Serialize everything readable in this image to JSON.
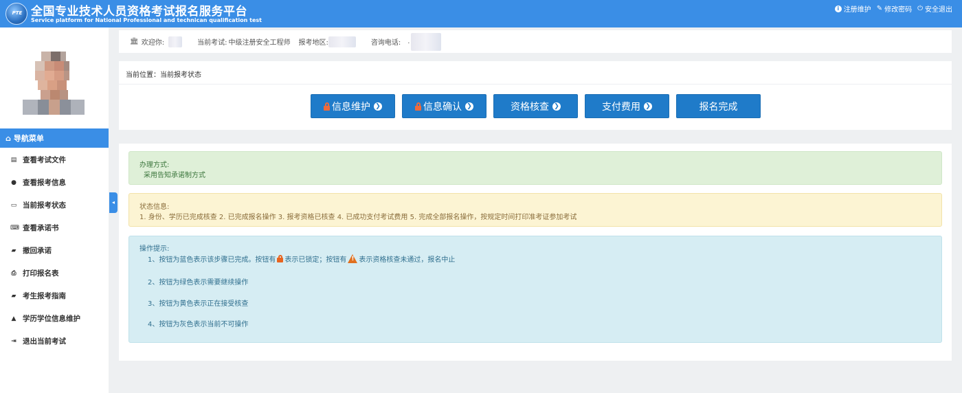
{
  "header": {
    "logo_text": "PTE",
    "title_cn": "全国专业技术人员资格考试报名服务平台",
    "title_en": "Service platform for National Professional and technican qualification test",
    "links": [
      {
        "label": "注册维护",
        "icon": "info-icon"
      },
      {
        "label": "修改密码",
        "icon": "edit-icon"
      },
      {
        "label": "安全退出",
        "icon": "power-icon"
      }
    ]
  },
  "infobar": {
    "welcome_label": "欢迎你:",
    "exam_label": "当前考试:",
    "exam_value": "中级注册安全工程师",
    "region_label": "报考地区:",
    "phone_label": "咨询电话:",
    "phone_prefix": "."
  },
  "sidebar": {
    "nav_header": "导航菜单",
    "items": [
      {
        "label": "查看考试文件",
        "icon": "file-icon"
      },
      {
        "label": "查看报考信息",
        "icon": "info-circle-icon"
      },
      {
        "label": "当前报考状态",
        "icon": "monitor-icon"
      },
      {
        "label": "查看承诺书",
        "icon": "keyboard-icon"
      },
      {
        "label": "撤回承诺",
        "icon": "book-icon"
      },
      {
        "label": "打印报名表",
        "icon": "print-icon"
      },
      {
        "label": "考生报考指南",
        "icon": "book-icon"
      },
      {
        "label": "学历学位信息维护",
        "icon": "graduation-cap-icon"
      },
      {
        "label": "退出当前考试",
        "icon": "sign-out-icon"
      }
    ]
  },
  "status": {
    "breadcrumb": "当前位置：当前报考状态",
    "steps": [
      {
        "label": "信息维护",
        "locked": true,
        "arrow": true
      },
      {
        "label": "信息确认",
        "locked": true,
        "arrow": true
      },
      {
        "label": "资格核查",
        "locked": false,
        "arrow": true
      },
      {
        "label": "支付费用",
        "locked": false,
        "arrow": true
      },
      {
        "label": "报名完成",
        "locked": false,
        "arrow": false
      }
    ]
  },
  "alerts": {
    "method_title": "办理方式:",
    "method_text": "采用告知承诺制方式",
    "status_title": "状态信息:",
    "status_text": "1. 身份、学历已完成核查 2. 已完成报名操作 3. 报考资格已核查 4. 已成功支付考试费用 5. 完成全部报名操作，按规定时间打印准考证参加考试",
    "tips_title": "操作提示:",
    "tip1_a": "1、按钮为蓝色表示该步骤已完成。按钮有",
    "tip1_b": "表示已锁定；按钮有",
    "tip1_c": "表示资格核查未通过，报名中止",
    "tip2": "2、按钮为绿色表示需要继续操作",
    "tip3": "3、按钮为黄色表示正在接受核查",
    "tip4": "4、按钮为灰色表示当前不可操作"
  },
  "colors": {
    "primary": "#3a8ee6",
    "step_button": "#1f7bc9",
    "lock": "#f06a3a"
  }
}
